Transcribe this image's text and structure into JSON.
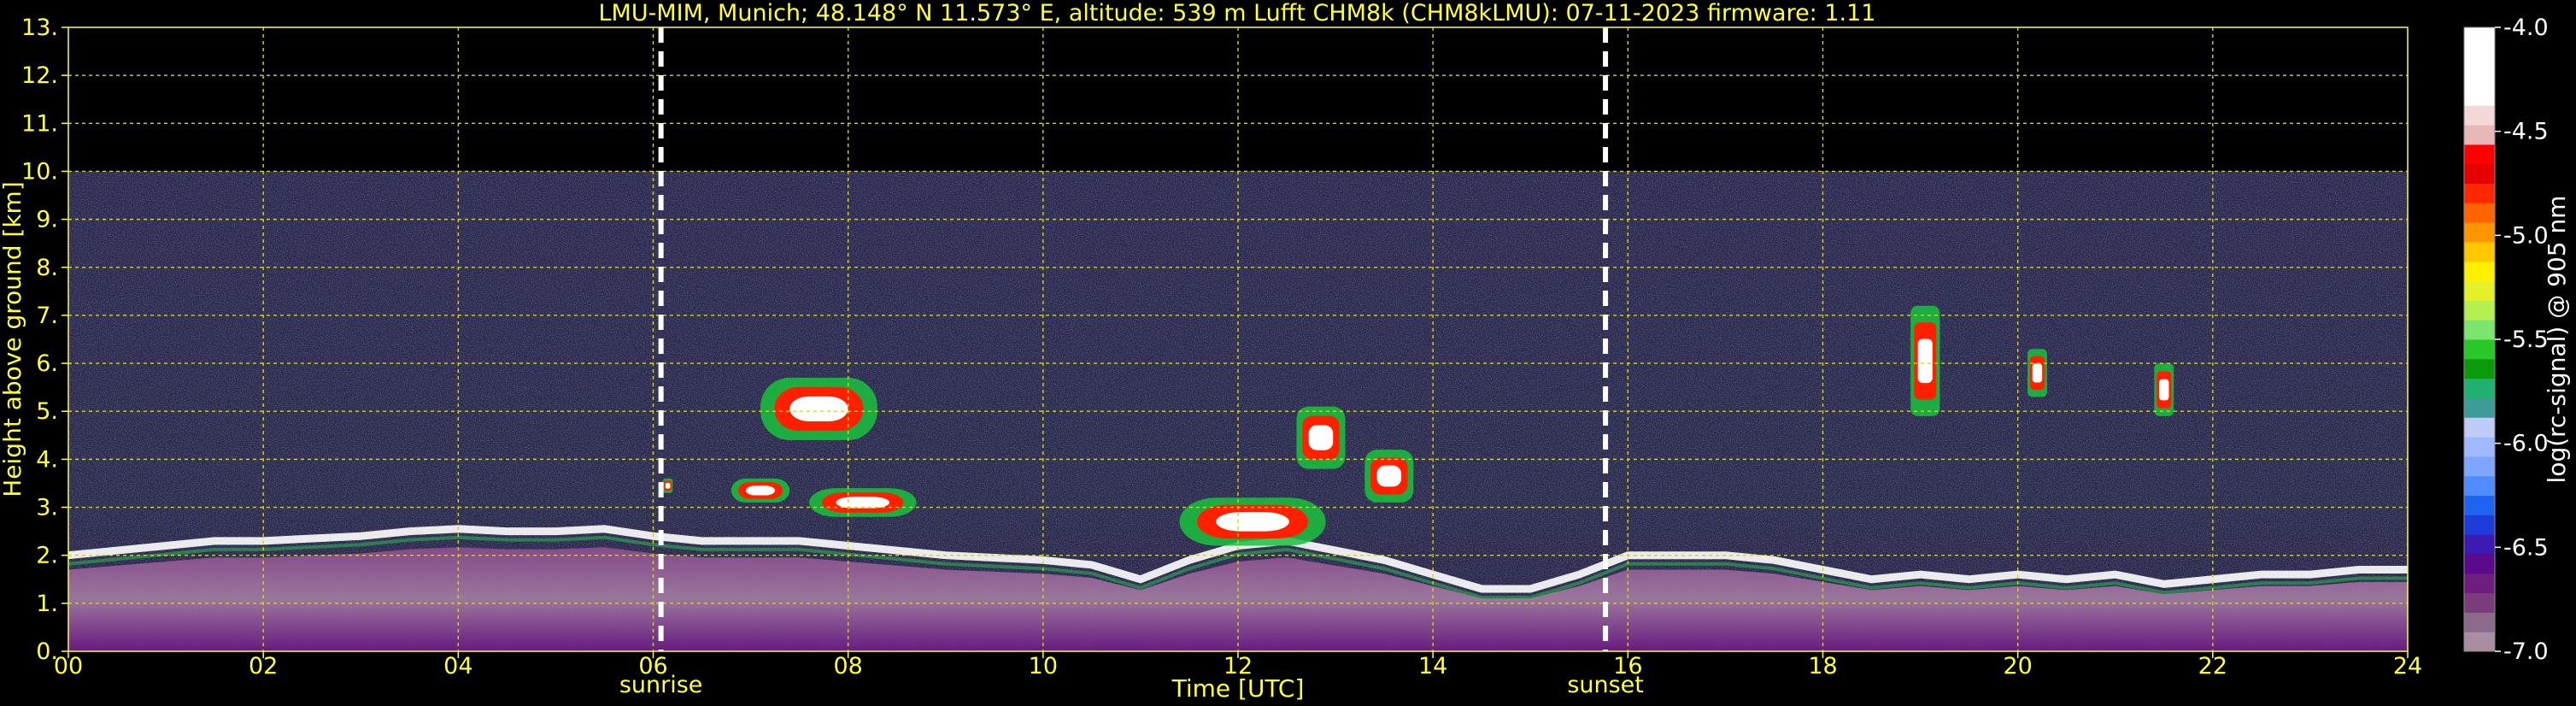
{
  "chart_data": {
    "type": "heatmap",
    "title": "LMU-MIM, Munich; 48.148° N 11.573° E, altitude: 539 m    Lufft CHM8k (CHM8kLMU): 07-11-2023    firmware: 1.11",
    "xlabel": "Time [UTC]",
    "ylabel": "Height above ground [km]",
    "xlim": [
      0,
      24
    ],
    "ylim": [
      0,
      13
    ],
    "x_ticks": [
      "00",
      "02",
      "04",
      "06",
      "08",
      "10",
      "12",
      "14",
      "16",
      "18",
      "20",
      "22",
      "24"
    ],
    "y_ticks": [
      "0.",
      "1.",
      "2.",
      "3.",
      "4.",
      "5.",
      "6.",
      "7.",
      "8.",
      "9.",
      "10.",
      "11.",
      "12.",
      "13."
    ],
    "grid": true,
    "data_top_km": 10,
    "events": [
      {
        "label": "sunrise",
        "time": 6.08
      },
      {
        "label": "sunset",
        "time": 15.77
      }
    ],
    "colorbar": {
      "label": "log(rc-signal) @ 905 nm",
      "range": [
        -7.0,
        -4.0
      ],
      "ticks": [
        "-4.0",
        "-4.5",
        "-5.0",
        "-5.5",
        "-6.0",
        "-6.5",
        "-7.0"
      ],
      "colors": [
        "#a88ea0",
        "#8c6a8c",
        "#7a3c7a",
        "#6e1e7e",
        "#5a0a8a",
        "#3c1ab4",
        "#1e3cdc",
        "#1e64f0",
        "#508cff",
        "#7ea6ff",
        "#a0b8ff",
        "#c0ccf8",
        "#3c9c96",
        "#20b070",
        "#0a9a0a",
        "#28c828",
        "#7ae66e",
        "#b4f050",
        "#e6f028",
        "#fff000",
        "#ffc800",
        "#ff9600",
        "#ff6400",
        "#ff2800",
        "#e60000",
        "#ff0000",
        "#e8b8b8",
        "#f4d8d8",
        "#ffffff",
        "#ffffff",
        "#ffffff",
        "#ffffff"
      ]
    },
    "boundary_layer_top_km": [
      [
        0,
        2.0
      ],
      [
        0.5,
        2.1
      ],
      [
        1,
        2.2
      ],
      [
        1.5,
        2.3
      ],
      [
        2,
        2.3
      ],
      [
        2.5,
        2.35
      ],
      [
        3,
        2.4
      ],
      [
        3.5,
        2.5
      ],
      [
        4,
        2.55
      ],
      [
        4.5,
        2.5
      ],
      [
        5,
        2.5
      ],
      [
        5.5,
        2.55
      ],
      [
        6,
        2.4
      ],
      [
        6.5,
        2.3
      ],
      [
        7,
        2.3
      ],
      [
        7.5,
        2.3
      ],
      [
        8,
        2.2
      ],
      [
        8.5,
        2.1
      ],
      [
        9,
        2.0
      ],
      [
        9.5,
        1.95
      ],
      [
        10,
        1.9
      ],
      [
        10.5,
        1.8
      ],
      [
        11,
        1.5
      ],
      [
        11.5,
        1.9
      ],
      [
        12,
        2.2
      ],
      [
        12.5,
        2.3
      ],
      [
        13,
        2.1
      ],
      [
        13.5,
        1.9
      ],
      [
        14,
        1.6
      ],
      [
        14.5,
        1.3
      ],
      [
        15,
        1.3
      ],
      [
        15.5,
        1.6
      ],
      [
        16,
        2.0
      ],
      [
        16.5,
        2.0
      ],
      [
        17,
        2.0
      ],
      [
        17.5,
        1.9
      ],
      [
        18,
        1.7
      ],
      [
        18.5,
        1.5
      ],
      [
        19,
        1.6
      ],
      [
        19.5,
        1.5
      ],
      [
        20,
        1.6
      ],
      [
        20.5,
        1.5
      ],
      [
        21,
        1.6
      ],
      [
        21.5,
        1.4
      ],
      [
        22,
        1.5
      ],
      [
        22.5,
        1.6
      ],
      [
        23,
        1.6
      ],
      [
        23.5,
        1.7
      ],
      [
        24,
        1.7
      ]
    ],
    "cloud_features": [
      {
        "time_start": 6.1,
        "time_end": 6.2,
        "height_base_km": 3.3,
        "height_top_km": 3.6
      },
      {
        "time_start": 6.8,
        "time_end": 7.4,
        "height_base_km": 3.1,
        "height_top_km": 3.6
      },
      {
        "time_start": 7.1,
        "time_end": 8.3,
        "height_base_km": 4.4,
        "height_top_km": 5.7
      },
      {
        "time_start": 7.6,
        "time_end": 8.7,
        "height_base_km": 2.8,
        "height_top_km": 3.4
      },
      {
        "time_start": 11.4,
        "time_end": 12.9,
        "height_base_km": 2.2,
        "height_top_km": 3.2
      },
      {
        "time_start": 12.6,
        "time_end": 13.1,
        "height_base_km": 3.8,
        "height_top_km": 5.1
      },
      {
        "time_start": 13.3,
        "time_end": 13.8,
        "height_base_km": 3.1,
        "height_top_km": 4.2
      },
      {
        "time_start": 18.9,
        "time_end": 19.2,
        "height_base_km": 4.9,
        "height_top_km": 7.2
      },
      {
        "time_start": 21.4,
        "time_end": 21.6,
        "height_base_km": 4.9,
        "height_top_km": 6.0
      },
      {
        "time_start": 20.1,
        "time_end": 20.3,
        "height_base_km": 5.3,
        "height_top_km": 6.3
      }
    ]
  }
}
